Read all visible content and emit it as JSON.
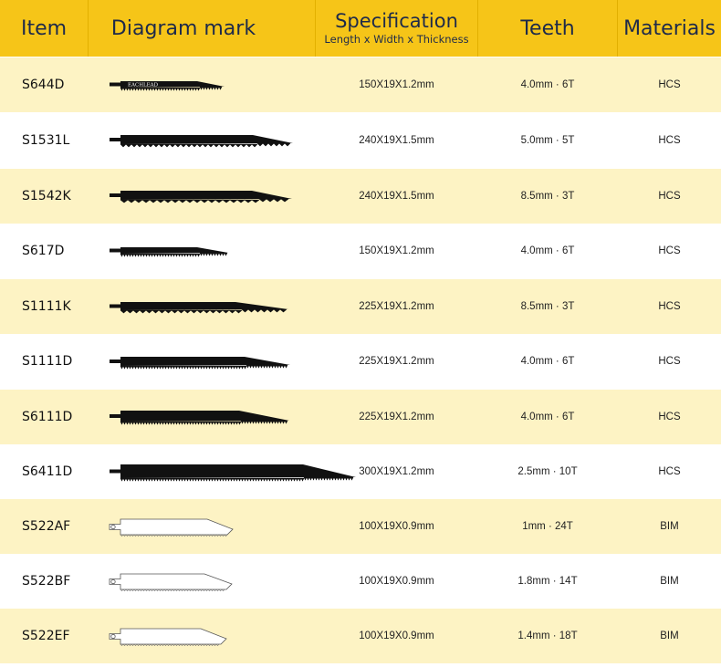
{
  "header": {
    "item": "Item",
    "diagram": "Diagram mark",
    "spec_title": "Specification",
    "spec_sub": "Length x Width x Thickness",
    "teeth": "Teeth",
    "materials": "Materials"
  },
  "rows": [
    {
      "item": "S644D",
      "spec": "150X19X1.2mm",
      "teeth": "4.0mm · 6T",
      "material": "HCS",
      "blade_label": "EACHLEAD"
    },
    {
      "item": "S1531L",
      "spec": "240X19X1.5mm",
      "teeth": "5.0mm · 5T",
      "material": "HCS"
    },
    {
      "item": "S1542K",
      "spec": "240X19X1.5mm",
      "teeth": "8.5mm · 3T",
      "material": "HCS"
    },
    {
      "item": "S617D",
      "spec": "150X19X1.2mm",
      "teeth": "4.0mm · 6T",
      "material": "HCS"
    },
    {
      "item": "S1111K",
      "spec": "225X19X1.2mm",
      "teeth": "8.5mm · 3T",
      "material": "HCS"
    },
    {
      "item": "S1111D",
      "spec": "225X19X1.2mm",
      "teeth": "4.0mm · 6T",
      "material": "HCS"
    },
    {
      "item": "S6111D",
      "spec": "225X19X1.2mm",
      "teeth": "4.0mm · 6T",
      "material": "HCS"
    },
    {
      "item": "S6411D",
      "spec": "300X19X1.2mm",
      "teeth": "2.5mm · 10T",
      "material": "HCS"
    },
    {
      "item": "S522AF",
      "spec": "100X19X0.9mm",
      "teeth": "1mm · 24T",
      "material": "BIM"
    },
    {
      "item": "S522BF",
      "spec": "100X19X0.9mm",
      "teeth": "1.8mm · 14T",
      "material": "BIM"
    },
    {
      "item": "S522EF",
      "spec": "100X19X0.9mm",
      "teeth": "1.4mm · 18T",
      "material": "BIM"
    }
  ]
}
